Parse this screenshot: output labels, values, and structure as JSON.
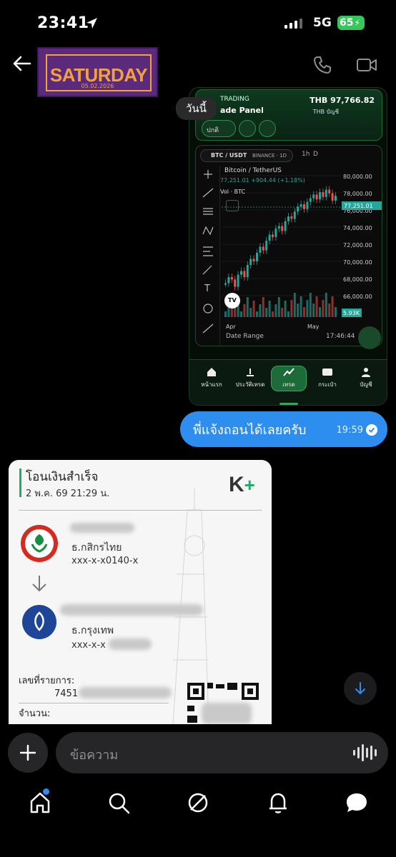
{
  "status": {
    "time": "23:41",
    "network": "5G",
    "battery": "65"
  },
  "header": {
    "banner_title": "SATURDAY",
    "banner_date": "05.02.2026"
  },
  "screenshot": {
    "app_label": "TRADING",
    "panel_title": "ade Panel",
    "balance": "THB 97,766.82",
    "balance_sub": "THB บัญชี",
    "mode_button": "ปกติ",
    "pair": "BTC / USDT",
    "exchange": "BINANCE · 1D",
    "interval": "1h",
    "interval2": "D",
    "instrument": "Bitcoin / TetherUS",
    "quote": "77,251.01 +904.44 (+1.18%)",
    "vol_label": "Vol · BTC",
    "price_axis": [
      "80,000.00",
      "78,000.00",
      "76,000.00",
      "74,000.00",
      "72,000.00",
      "70,000.00",
      "68,000.00",
      "66,000.00"
    ],
    "last_price_tag": "77,251.01",
    "vol_tag": "5.93K",
    "time_axis": [
      "Apr",
      "May"
    ],
    "date_range": "Date Range",
    "clock": "17:46:44",
    "tradingview_mark": "TV",
    "nav": [
      {
        "label": "หน้าแรก",
        "icon": "home-icon"
      },
      {
        "label": "ประวัติเทรด",
        "icon": "history-icon"
      },
      {
        "label": "เทรด",
        "icon": "chart-line-icon"
      },
      {
        "label": "กระเป๋า",
        "icon": "wallet-icon"
      },
      {
        "label": "บัญชี",
        "icon": "user-icon"
      }
    ]
  },
  "today_pill": "วันนี้",
  "outgoing": {
    "text": "พี่แจ้งถอนได้เลยครับ",
    "time": "19:59"
  },
  "slip": {
    "title": "โอนเงินสำเร็จ",
    "date": "2 พ.ค. 69 21:29 น.",
    "logo": "K",
    "logo_plus": "+",
    "from_bank": "ธ.กสิกรไทย",
    "from_account": "xxx-x-x0140-x",
    "to_bank": "ธ.กรุงเทพ",
    "to_account": "xxx-x-x",
    "ref_label": "เลขที่รายการ:",
    "ref_value": "7451",
    "amount_label": "จำนวน:"
  },
  "composer": {
    "placeholder": "ข้อความ"
  },
  "colors": {
    "accent": "#2d8ef0",
    "trading_green": "#1c6b38",
    "kbank_green": "#27a86a"
  }
}
